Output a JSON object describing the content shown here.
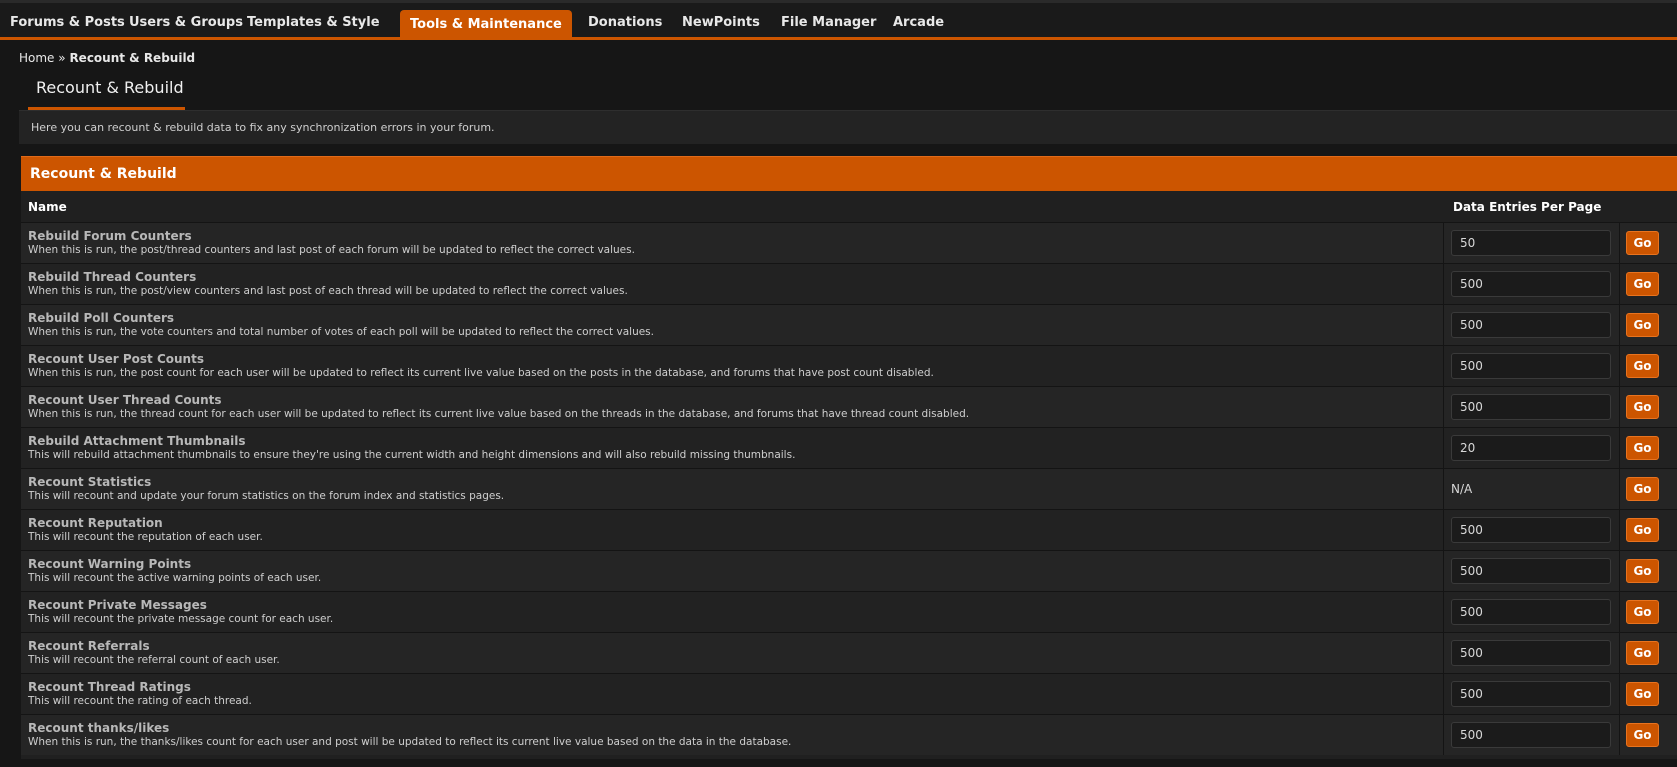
{
  "nav": {
    "tabs": [
      {
        "label": "Forums & Posts"
      },
      {
        "label": "Users & Groups"
      },
      {
        "label": "Templates & Style"
      },
      {
        "label": "Tools & Maintenance"
      },
      {
        "label": "Donations"
      },
      {
        "label": "NewPoints"
      },
      {
        "label": "File Manager"
      },
      {
        "label": "Arcade"
      }
    ],
    "active_tab": "Tools & Maintenance"
  },
  "breadcrumb": {
    "home": "Home",
    "separator": "»",
    "current": "Recount & Rebuild"
  },
  "page": {
    "title": "Recount & Rebuild",
    "description": "Here you can recount & rebuild data to fix any synchronization errors in your forum."
  },
  "panel": {
    "title": "Recount & Rebuild",
    "columns": {
      "name": "Name",
      "entries": "Data Entries Per Page"
    },
    "go_label": "Go",
    "rows": [
      {
        "name": "Rebuild Forum Counters",
        "desc": "When this is run, the post/thread counters and last post of each forum will be updated to reflect the correct values.",
        "entries": "50"
      },
      {
        "name": "Rebuild Thread Counters",
        "desc": "When this is run, the post/view counters and last post of each thread will be updated to reflect the correct values.",
        "entries": "500"
      },
      {
        "name": "Rebuild Poll Counters",
        "desc": "When this is run, the vote counters and total number of votes of each poll will be updated to reflect the correct values.",
        "entries": "500"
      },
      {
        "name": "Recount User Post Counts",
        "desc": "When this is run, the post count for each user will be updated to reflect its current live value based on the posts in the database, and forums that have post count disabled.",
        "entries": "500"
      },
      {
        "name": "Recount User Thread Counts",
        "desc": "When this is run, the thread count for each user will be updated to reflect its current live value based on the threads in the database, and forums that have thread count disabled.",
        "entries": "500"
      },
      {
        "name": "Rebuild Attachment Thumbnails",
        "desc": "This will rebuild attachment thumbnails to ensure they're using the current width and height dimensions and will also rebuild missing thumbnails.",
        "entries": "20"
      },
      {
        "name": "Recount Statistics",
        "desc": "This will recount and update your forum statistics on the forum index and statistics pages.",
        "entries": "N/A"
      },
      {
        "name": "Recount Reputation",
        "desc": "This will recount the reputation of each user.",
        "entries": "500"
      },
      {
        "name": "Recount Warning Points",
        "desc": "This will recount the active warning points of each user.",
        "entries": "500"
      },
      {
        "name": "Recount Private Messages",
        "desc": "This will recount the private message count for each user.",
        "entries": "500"
      },
      {
        "name": "Recount Referrals",
        "desc": "This will recount the referral count of each user.",
        "entries": "500"
      },
      {
        "name": "Recount Thread Ratings",
        "desc": "This will recount the rating of each thread.",
        "entries": "500"
      },
      {
        "name": "Recount thanks/likes",
        "desc": "When this is run, the thanks/likes count for each user and post will be updated to reflect its current live value based on the data in the database.",
        "entries": "500"
      }
    ]
  },
  "colors": {
    "accent": "#cc5500",
    "background": "#161616",
    "row": "#252525"
  }
}
